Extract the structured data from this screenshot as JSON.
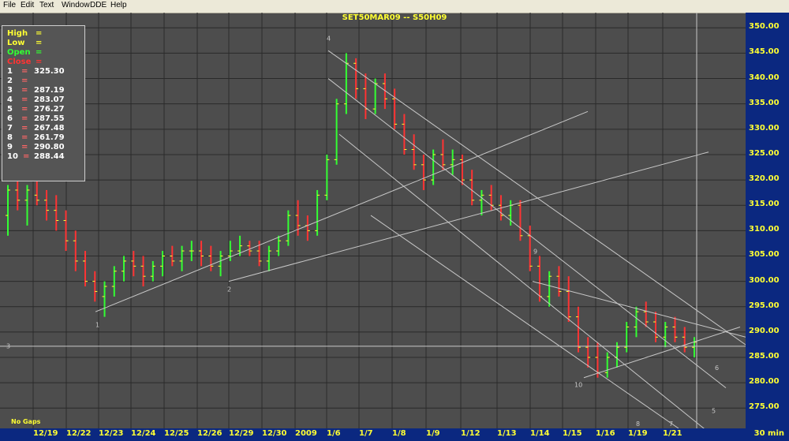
{
  "menu": [
    "File",
    "Edit",
    "Text",
    "Window",
    "DDE",
    "Help"
  ],
  "title": "SET50MAR09  --  S50H09",
  "colors": {
    "background": "#4d4d4d",
    "grid": "#2a2a2a",
    "axis_bg": "#0b2880",
    "axis_text": "#ffff33",
    "bar_up": "#33ff33",
    "bar_down": "#ff3333",
    "trend_line": "#c8c8c8"
  },
  "legend": {
    "ohlc": [
      {
        "label": "High",
        "value": "=",
        "color": "#ffff33"
      },
      {
        "label": "Low",
        "value": "=",
        "color": "#ffff33"
      },
      {
        "label": "Open",
        "value": "=",
        "color": "#33ff33"
      },
      {
        "label": "Close",
        "value": "=",
        "color": "#ff3333"
      }
    ],
    "points": [
      {
        "n": "1",
        "eq": "=",
        "v": "325.30"
      },
      {
        "n": "2",
        "eq": "=",
        "v": ""
      },
      {
        "n": "3",
        "eq": "=",
        "v": "287.19"
      },
      {
        "n": "4",
        "eq": "=",
        "v": "283.07"
      },
      {
        "n": "5",
        "eq": "=",
        "v": "276.27"
      },
      {
        "n": "6",
        "eq": "=",
        "v": "287.55"
      },
      {
        "n": "7",
        "eq": "=",
        "v": "267.48"
      },
      {
        "n": "8",
        "eq": "=",
        "v": "261.79"
      },
      {
        "n": "9",
        "eq": "=",
        "v": "290.80"
      },
      {
        "n": "10",
        "eq": "=",
        "v": "288.44"
      }
    ]
  },
  "footer": {
    "no_gaps": "No  Gaps",
    "timeframe": "30  min"
  },
  "chart_data": {
    "type": "bar",
    "title": "SET50MAR09  --  S50H09",
    "subtype": "ohlc",
    "categories": [
      "12/19",
      "12/22",
      "12/23",
      "12/24",
      "12/25",
      "12/26",
      "12/29",
      "12/30",
      "2009",
      "1/6",
      "1/7",
      "1/8",
      "1/9",
      "1/12",
      "1/13",
      "1/14",
      "1/15",
      "1/16",
      "1/19",
      "1/21"
    ],
    "y_ticks": [
      275,
      280,
      285,
      290,
      295,
      300,
      305,
      310,
      315,
      320,
      325,
      330,
      335,
      340,
      345,
      350
    ],
    "ylim": [
      271,
      353
    ],
    "series": [
      {
        "values": [
          [
            313,
            319,
            309,
            318
          ],
          [
            318,
            321,
            314,
            316
          ],
          [
            316,
            319,
            311,
            318
          ],
          [
            317,
            320,
            315,
            316
          ],
          [
            316,
            318,
            312,
            314
          ],
          [
            314,
            317,
            310,
            312
          ],
          [
            312,
            314,
            306,
            308
          ],
          [
            308,
            310,
            302,
            304
          ],
          [
            304,
            306,
            299,
            300
          ],
          [
            300,
            302,
            296,
            298
          ],
          [
            297,
            300,
            293,
            299
          ],
          [
            299,
            303,
            297,
            302
          ],
          [
            302,
            305,
            300,
            304
          ],
          [
            304,
            306,
            301,
            303
          ],
          [
            303,
            305,
            299,
            301
          ],
          [
            301,
            304,
            300,
            303
          ],
          [
            303,
            306,
            301,
            305
          ],
          [
            305,
            307,
            303,
            304
          ],
          [
            304,
            307,
            302,
            306
          ],
          [
            306,
            308,
            304,
            306
          ],
          [
            306,
            308,
            303,
            305
          ],
          [
            305,
            307,
            302,
            303
          ],
          [
            303,
            306,
            301,
            305
          ],
          [
            305,
            308,
            304,
            306
          ],
          [
            306,
            309,
            305,
            307
          ],
          [
            307,
            308,
            305,
            306
          ],
          [
            306,
            308,
            303,
            304
          ],
          [
            304,
            307,
            302,
            306
          ],
          [
            306,
            309,
            305,
            308
          ],
          [
            308,
            314,
            307,
            313
          ],
          [
            313,
            316,
            309,
            311
          ],
          [
            311,
            313,
            308,
            310
          ],
          [
            310,
            318,
            309,
            317
          ],
          [
            317,
            325,
            316,
            324
          ],
          [
            324,
            336,
            323,
            335
          ],
          [
            335,
            345,
            333,
            343
          ],
          [
            343,
            344,
            336,
            338
          ],
          [
            338,
            341,
            332,
            334
          ],
          [
            334,
            340,
            333,
            339
          ],
          [
            339,
            341,
            334,
            336
          ],
          [
            336,
            338,
            330,
            331
          ],
          [
            331,
            333,
            325,
            326
          ],
          [
            326,
            329,
            322,
            323
          ],
          [
            323,
            325,
            318,
            320
          ],
          [
            320,
            326,
            319,
            325
          ],
          [
            325,
            328,
            322,
            323
          ],
          [
            323,
            326,
            321,
            324
          ],
          [
            324,
            325,
            319,
            320
          ],
          [
            320,
            322,
            315,
            316
          ],
          [
            316,
            318,
            313,
            317
          ],
          [
            317,
            319,
            314,
            315
          ],
          [
            315,
            317,
            312,
            313
          ],
          [
            313,
            316,
            311,
            315
          ],
          [
            315,
            316,
            308,
            309
          ],
          [
            309,
            311,
            302,
            303
          ],
          [
            303,
            305,
            296,
            297
          ],
          [
            297,
            302,
            295,
            301
          ],
          [
            301,
            303,
            297,
            298
          ],
          [
            298,
            301,
            292,
            293
          ],
          [
            293,
            295,
            286,
            287
          ],
          [
            287,
            289,
            283,
            285
          ],
          [
            285,
            288,
            281,
            282
          ],
          [
            282,
            286,
            281,
            285
          ],
          [
            285,
            288,
            283,
            287
          ],
          [
            287,
            292,
            286,
            291
          ],
          [
            291,
            295,
            289,
            294
          ],
          [
            294,
            296,
            291,
            292
          ],
          [
            292,
            294,
            288,
            289
          ],
          [
            289,
            292,
            287,
            291
          ],
          [
            291,
            293,
            288,
            289
          ],
          [
            289,
            291,
            286,
            287
          ],
          [
            287,
            289,
            285,
            288
          ]
        ]
      }
    ],
    "annotations": [
      "1",
      "2",
      "3",
      "4",
      "5",
      "6",
      "7",
      "8",
      "9",
      "10"
    ]
  }
}
